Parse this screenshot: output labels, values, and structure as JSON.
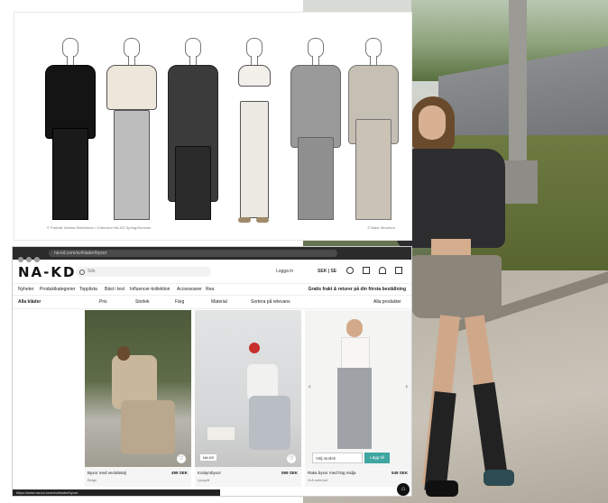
{
  "sketch": {
    "caption_left": "© Portrait: Marina Ekelöfsson / Collection NA-KD Spring/Summer",
    "caption_right": "© Babe Structure",
    "figures": [
      {
        "icon": "black-oversized-suit-sketch"
      },
      {
        "icon": "cream-top-grey-trousers-sketch"
      },
      {
        "icon": "dark-faux-fur-coat-sketch"
      },
      {
        "icon": "bralette-leggings-sketch"
      },
      {
        "icon": "grey-blazer-suit-sketch"
      },
      {
        "icon": "beige-belted-suit-sketch"
      }
    ]
  },
  "browser": {
    "url": "na-kd.com/sv/klader/byxor",
    "logo": "NA-KD",
    "search_placeholder": "Sök",
    "login": "Logga in",
    "language": "SEK | SE",
    "nav_items": [
      "Nyheter",
      "Produktkategorier",
      "Topplista",
      "Bäst i test",
      "Influencer-kollektion",
      "Accessoarer",
      "Rea"
    ],
    "promo": "Gratis frakt & returer på din första beställning",
    "filters": [
      "Alla kläder",
      "Pris",
      "Storlek",
      "Färg",
      "Material",
      "Sortera på relevans"
    ],
    "filter_right": "Alla produkter",
    "products": [
      {
        "name": "Byxor med veckdetalj",
        "price": "499 SEK",
        "sub": "Beige",
        "badge": ""
      },
      {
        "name": "Kostymbyxor",
        "price": "599 SEK",
        "sub": "Ljusgrå",
        "badge": "NA-KD"
      },
      {
        "name": "Raka byxor med hög midja",
        "price": "549 SEK",
        "sub": "Grå melerad",
        "size": "Välj storlek",
        "buy": "Lägg till"
      }
    ],
    "status": "https://www.na-kd.com/sv/klader/byxor",
    "fab_icon": "chat-icon"
  }
}
